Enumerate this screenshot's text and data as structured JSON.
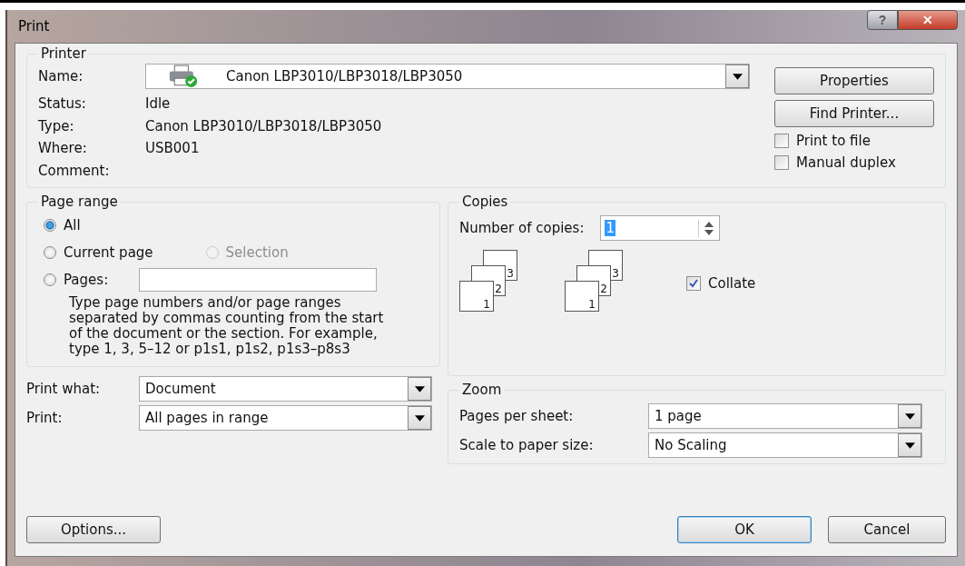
{
  "window": {
    "title": "Print",
    "buttons": [
      {
        "kind": "help",
        "label": "?"
      },
      {
        "kind": "close",
        "label": "✕"
      }
    ]
  },
  "printer": {
    "title": "Printer",
    "name_label": "Name:",
    "name_value": "Canon LBP3010/LBP3018/LBP3050",
    "info": [
      {
        "label": "Status:",
        "value": "Idle"
      },
      {
        "label": "Type:",
        "value": "Canon LBP3010/LBP3018/LBP3050"
      },
      {
        "label": "Where:",
        "value": "USB001"
      },
      {
        "label": "Comment:"
      }
    ],
    "buttons": [
      "Properties",
      "Find Printer..."
    ],
    "checkboxes": [
      {
        "label": "Print to file",
        "checked": false
      },
      {
        "label": "Manual duplex",
        "checked": false
      }
    ]
  },
  "page_range": {
    "title": "Page range",
    "options": [
      {
        "label": "All",
        "selected": true,
        "disabled": false
      },
      {
        "label": "Current page",
        "selected": false,
        "disabled": false
      },
      {
        "label": "Selection",
        "selected": false,
        "disabled": true
      },
      {
        "label": "Pages:",
        "selected": false,
        "disabled": false
      }
    ],
    "hint": "Type page numbers and/or page ranges separated by commas counting from the start of the document or the section. For example, type 1, 3, 5–12 or p1s1, p1s2, p1s3–p8s3"
  },
  "copies": {
    "title": "Copies",
    "label": "Number of copies:",
    "value": "1",
    "stacks": [
      [
        "3",
        "2",
        "1"
      ],
      [
        "3",
        "2",
        "1"
      ]
    ],
    "collate": {
      "label": "Collate",
      "checked": true
    }
  },
  "print_options": [
    {
      "label": "Print what:",
      "value": "Document"
    },
    {
      "label": "Print:",
      "value": "All pages in range"
    }
  ],
  "zoom": {
    "title": "Zoom",
    "fields": [
      {
        "label": "Pages per sheet:",
        "value": "1 page"
      },
      {
        "label": "Scale to paper size:",
        "value": "No Scaling"
      }
    ]
  },
  "footer": {
    "options_button": "Options...",
    "ok_button": "OK",
    "cancel_button": "Cancel"
  }
}
